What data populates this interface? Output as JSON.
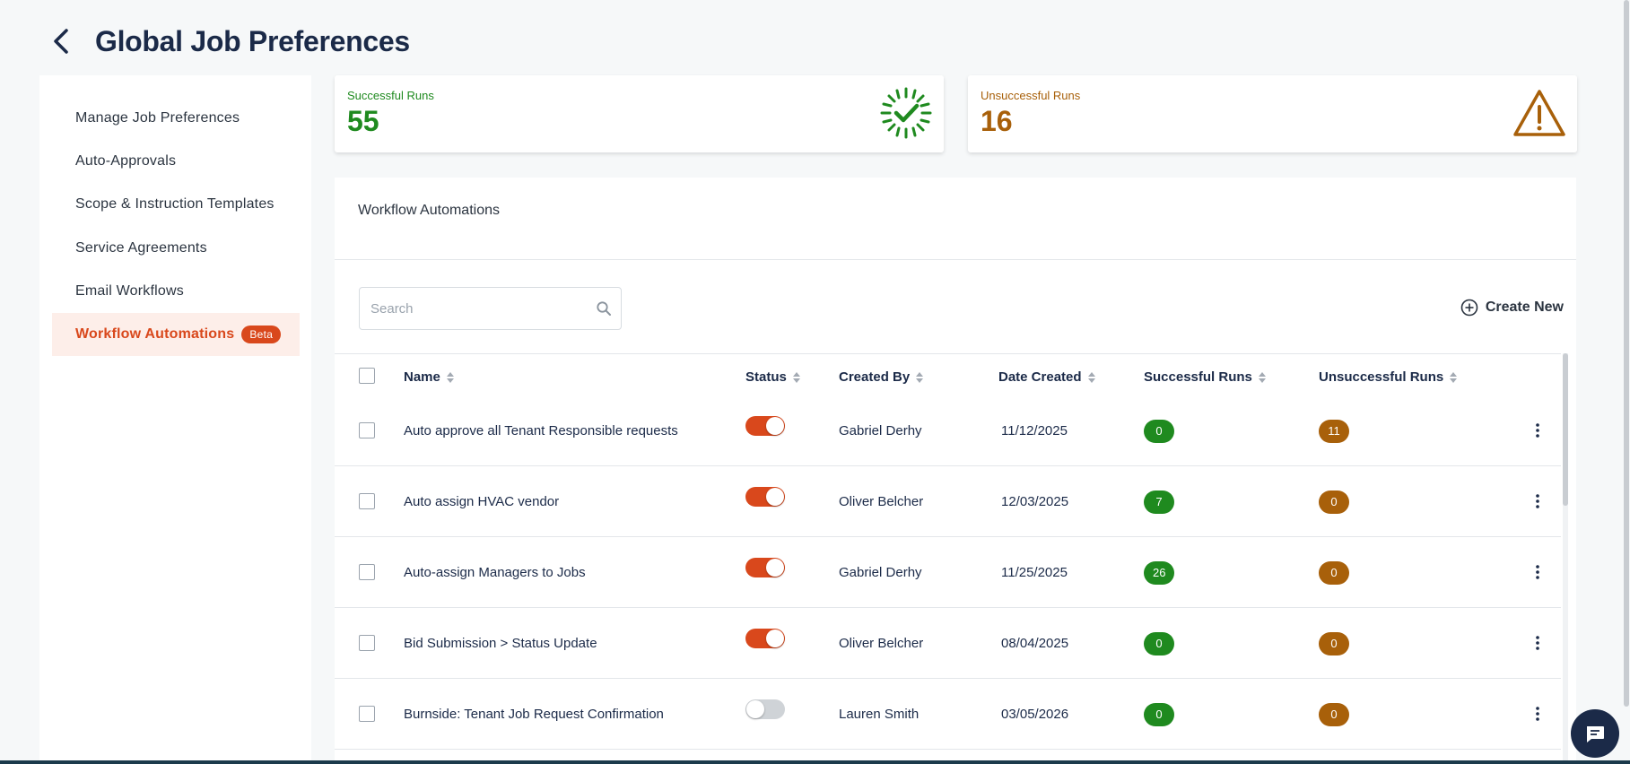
{
  "header": {
    "title": "Global Job Preferences"
  },
  "sidebar": {
    "items": [
      {
        "label": "Manage Job Preferences"
      },
      {
        "label": "Auto-Approvals"
      },
      {
        "label": "Scope & Instruction Templates"
      },
      {
        "label": "Service Agreements"
      },
      {
        "label": "Email Workflows"
      },
      {
        "label": "Workflow Automations",
        "badge": "Beta",
        "active": true
      }
    ]
  },
  "stats": {
    "successful": {
      "label": "Successful Runs",
      "value": "55",
      "color": "#1f8a1f",
      "icon": "check-badge-icon"
    },
    "unsuccessful": {
      "label": "Unsuccessful Runs",
      "value": "16",
      "color": "#a8600a",
      "icon": "warning-triangle-icon"
    }
  },
  "panel": {
    "title": "Workflow Automations",
    "search_placeholder": "Search",
    "create_label": "Create New"
  },
  "table": {
    "columns": [
      "Name",
      "Status",
      "Created By",
      "Date Created",
      "Successful Runs",
      "Unsuccessful Runs"
    ],
    "rows": [
      {
        "name": "Auto approve all Tenant Responsible requests",
        "status": true,
        "created_by": "Gabriel Derhy",
        "date": "11/12/2025",
        "successful": "0",
        "unsuccessful": "11"
      },
      {
        "name": "Auto assign HVAC vendor",
        "status": true,
        "created_by": "Oliver Belcher",
        "date": "12/03/2025",
        "successful": "7",
        "unsuccessful": "0"
      },
      {
        "name": "Auto-assign Managers to Jobs",
        "status": true,
        "created_by": "Gabriel Derhy",
        "date": "11/25/2025",
        "successful": "26",
        "unsuccessful": "0"
      },
      {
        "name": "Bid Submission > Status Update",
        "status": true,
        "created_by": "Oliver Belcher",
        "date": "08/04/2025",
        "successful": "0",
        "unsuccessful": "0"
      },
      {
        "name": "Burnside: Tenant Job Request Confirmation",
        "status": false,
        "created_by": "Lauren Smith",
        "date": "03/05/2026",
        "successful": "0",
        "unsuccessful": "0"
      }
    ]
  },
  "colors": {
    "accent": "#d9481c",
    "success": "#1f8a1f",
    "warning": "#a8600a",
    "navy": "#1b2a48"
  }
}
